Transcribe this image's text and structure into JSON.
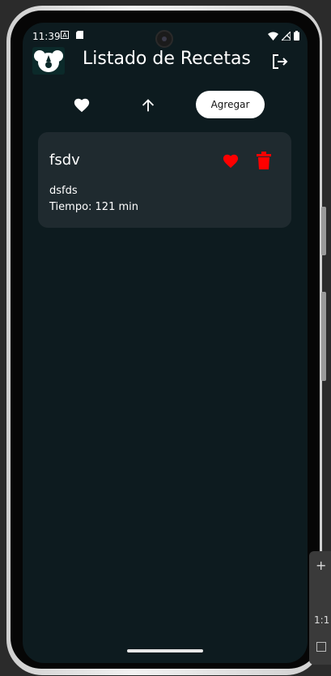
{
  "status_bar": {
    "time": "11:39"
  },
  "app_bar": {
    "title": "Listado de Recetas",
    "logo_icon": "koala-logo-icon",
    "logout_icon": "logout-icon"
  },
  "toolbar": {
    "favorites_icon": "heart-icon",
    "sort_icon": "arrow-up-icon",
    "add_label": "Agregar"
  },
  "recipes": [
    {
      "title": "fsdv",
      "description": "dsfds",
      "time_text": "Tiempo: 121 min",
      "favorite": true
    }
  ],
  "emulator_panel": {
    "zoom_ratio": "1:1"
  },
  "colors": {
    "background": "#0d1b1f",
    "card": "#1f2a2f",
    "accent_red": "#ff0000",
    "button_bg": "#ffffff"
  }
}
